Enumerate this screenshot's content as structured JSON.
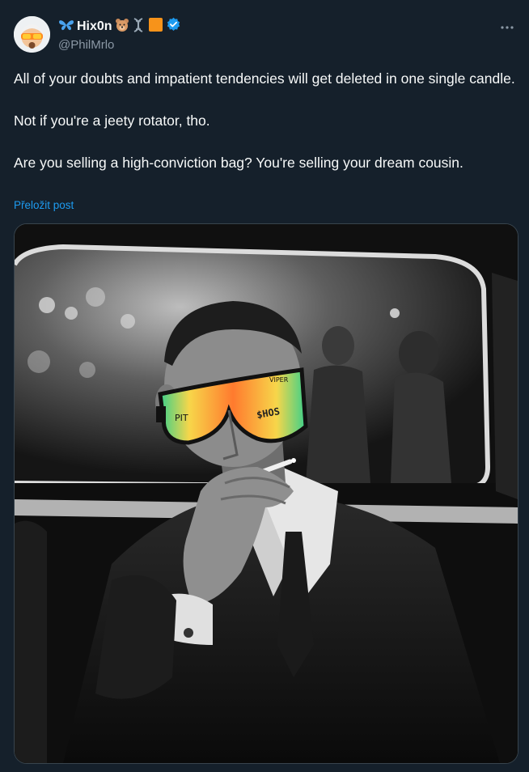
{
  "author": {
    "display_name": "Hix0n",
    "handle": "@PhilMrlo",
    "emojis": [
      "butterfly-icon",
      "bear-icon",
      "dna-icon",
      "orange-square-icon"
    ],
    "verified": true,
    "verified_color": "#1d9bf0"
  },
  "tweet": {
    "paragraphs": [
      "All of your doubts and impatient tendencies will get deleted in one single candle.",
      "Not if you're a jeety rotator, tho.",
      "Are you selling a high-conviction bag? You're selling your dream cousin."
    ],
    "translate_label": "Přeložit post"
  },
  "media": {
    "description_icon": "photo",
    "glasses_text_left": "PIT",
    "glasses_text_right": "VIPER",
    "glasses_text_brand": "$HOS"
  },
  "colors": {
    "background": "#15202b",
    "text": "#f7f9f9",
    "secondary": "#8b98a5",
    "link": "#1d9bf0"
  }
}
